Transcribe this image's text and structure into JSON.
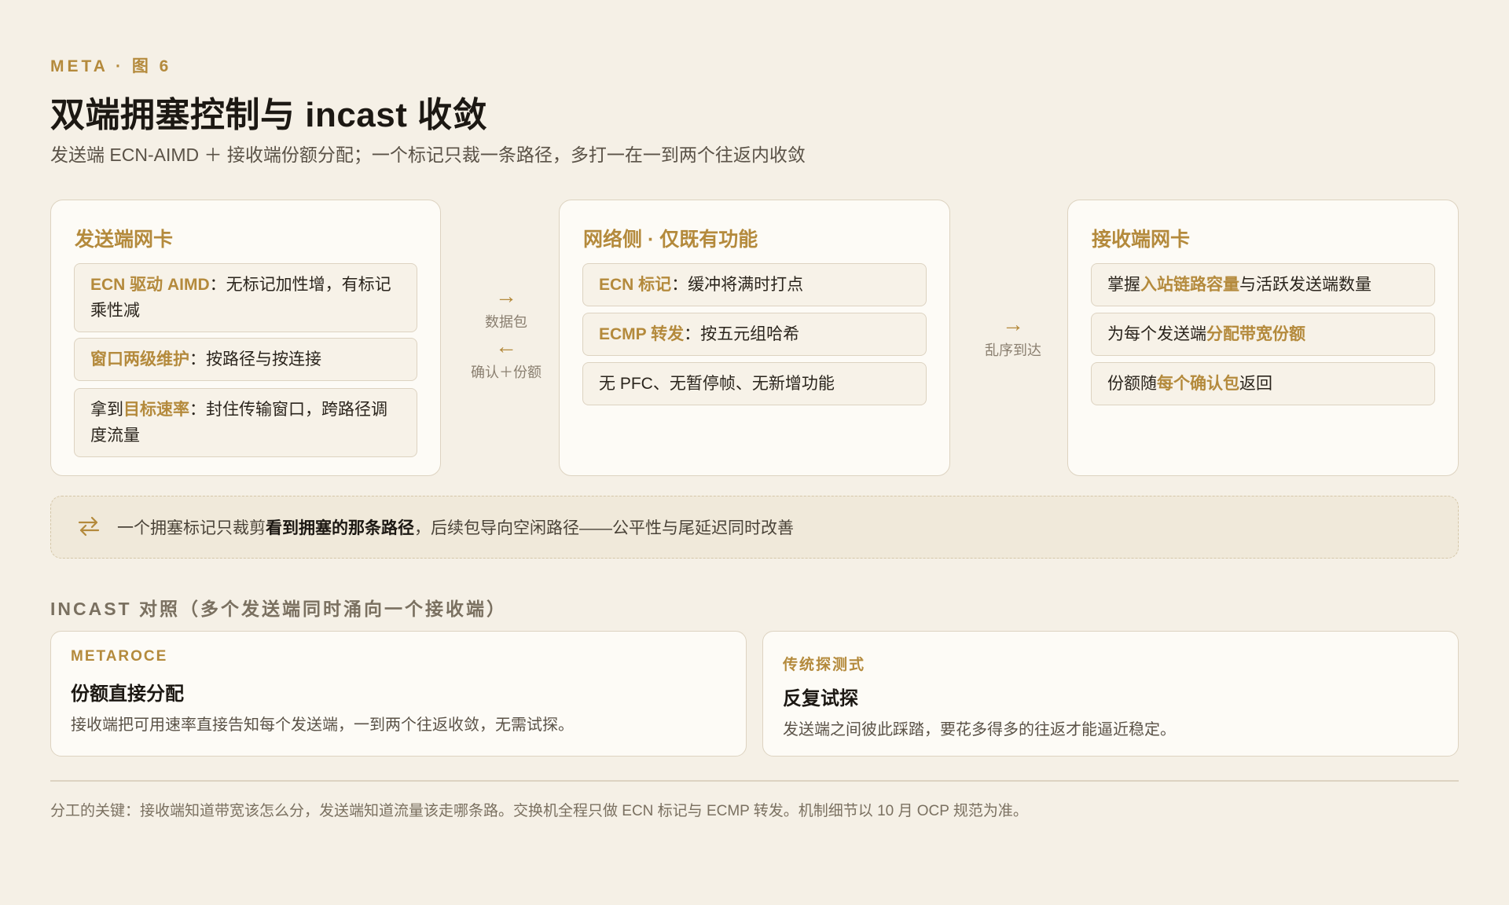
{
  "header": {
    "kicker": "META · 图 6",
    "title": "双端拥塞控制与 incast 收敛",
    "subtitle": "发送端 ECN-AIMD ＋ 接收端份额分配；一个标记只裁一条路径，多打一在一到两个往返内收敛"
  },
  "panels": {
    "sender": {
      "title": "发送端网卡",
      "items": [
        {
          "hl": "ECN 驱动 AIMD",
          "rest": "：无标记加性增，有标记乘性减"
        },
        {
          "hl": "窗口两级维护",
          "rest": "：按路径与按连接"
        },
        {
          "pre": "拿到",
          "hl": "目标速率",
          "rest": "：封住传输窗口，跨路径调度流量"
        }
      ]
    },
    "network": {
      "title": "网络侧 · 仅既有功能",
      "items": [
        {
          "hl": "ECN 标记",
          "rest": "：缓冲将满时打点"
        },
        {
          "hl": "ECMP 转发",
          "rest": "：按五元组哈希"
        },
        {
          "plain": "无 PFC、无暂停帧、无新增功能"
        }
      ]
    },
    "receiver": {
      "title": "接收端网卡",
      "items": [
        {
          "pre": "掌握",
          "hl": "入站链路容量",
          "rest": "与活跃发送端数量"
        },
        {
          "pre": "为每个发送端",
          "hl": "分配带宽份额",
          "rest": ""
        },
        {
          "pre": "份额随",
          "hl": "每个确认包",
          "rest": "返回"
        }
      ]
    }
  },
  "connectors": {
    "left": {
      "forward_label": "数据包",
      "back_label": "确认＋份额",
      "forward_icon": "arrow-right-icon",
      "back_icon": "arrow-left-icon"
    },
    "right": {
      "forward_label": "乱序到达",
      "forward_icon": "arrow-right-icon"
    }
  },
  "note": {
    "icon": "swap-arrows-icon",
    "pre": "一个拥塞标记只裁剪",
    "bold": "看到拥塞的那条路径",
    "post": "，后续包导向空闲路径——公平性与尾延迟同时改善"
  },
  "incast": {
    "label": "INCAST 对照（多个发送端同时涌向一个接收端）",
    "metaroce": {
      "tag": "METAROCE",
      "heading": "份额直接分配",
      "desc": "接收端把可用速率直接告知每个发送端，一到两个往返收敛，无需试探。"
    },
    "traditional": {
      "tag": "传统探测式",
      "heading": "反复试探",
      "desc": "发送端之间彼此踩踏，要花多得多的往返才能逼近稳定。"
    }
  },
  "footnote": "分工的关键：接收端知道带宽该怎么分，发送端知道流量该走哪条路。交换机全程只做 ECN 标记与 ECMP 转发。机制细节以 10 月 OCP 规范为准。",
  "colors": {
    "accent": "#b48a3c",
    "background": "#f5f0e6",
    "card": "#fdfbf6",
    "border": "#ddd3c1"
  }
}
